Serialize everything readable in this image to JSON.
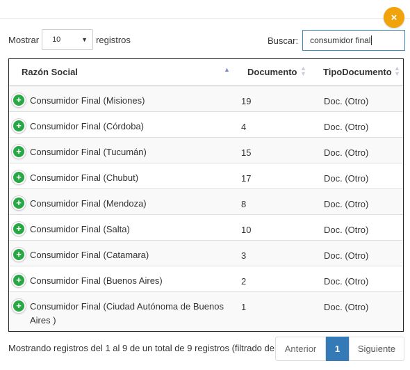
{
  "close_icon": "×",
  "length": {
    "label_before": "Mostrar",
    "value": "10",
    "label_after": "registros"
  },
  "search": {
    "label": "Buscar:",
    "value": "consumidor final"
  },
  "table": {
    "headers": [
      "Razón Social",
      "Documento",
      "TipoDocumento"
    ],
    "rows": [
      {
        "name": "Consumidor Final (Misiones)",
        "doc": "19",
        "tipo": "Doc. (Otro)"
      },
      {
        "name": "Consumidor Final (Córdoba)",
        "doc": "4",
        "tipo": "Doc. (Otro)"
      },
      {
        "name": "Consumidor Final (Tucumán)",
        "doc": "15",
        "tipo": "Doc. (Otro)"
      },
      {
        "name": "Consumidor Final (Chubut)",
        "doc": "17",
        "tipo": "Doc. (Otro)"
      },
      {
        "name": "Consumidor Final (Mendoza)",
        "doc": "8",
        "tipo": "Doc. (Otro)"
      },
      {
        "name": "Consumidor Final (Salta)",
        "doc": "10",
        "tipo": "Doc. (Otro)"
      },
      {
        "name": "Consumidor Final (Catamara)",
        "doc": "3",
        "tipo": "Doc. (Otro)"
      },
      {
        "name": "Consumidor Final (Buenos Aires)",
        "doc": "2",
        "tipo": "Doc. (Otro)"
      },
      {
        "name": "Consumidor Final (Ciudad Autónoma de Buenos Aires )",
        "doc": "1",
        "tipo": "Doc. (Otro)"
      }
    ]
  },
  "footer": {
    "info": "Mostrando registros del 1 al 9 de un total de 9 registros (filtrado de un total de registros)",
    "prev": "Anterior",
    "current": "1",
    "next": "Siguiente"
  },
  "colors": {
    "accent": "#337ab7",
    "close": "#f0a30a",
    "plus": "#28a745",
    "search_border": "#3c8dbc"
  }
}
